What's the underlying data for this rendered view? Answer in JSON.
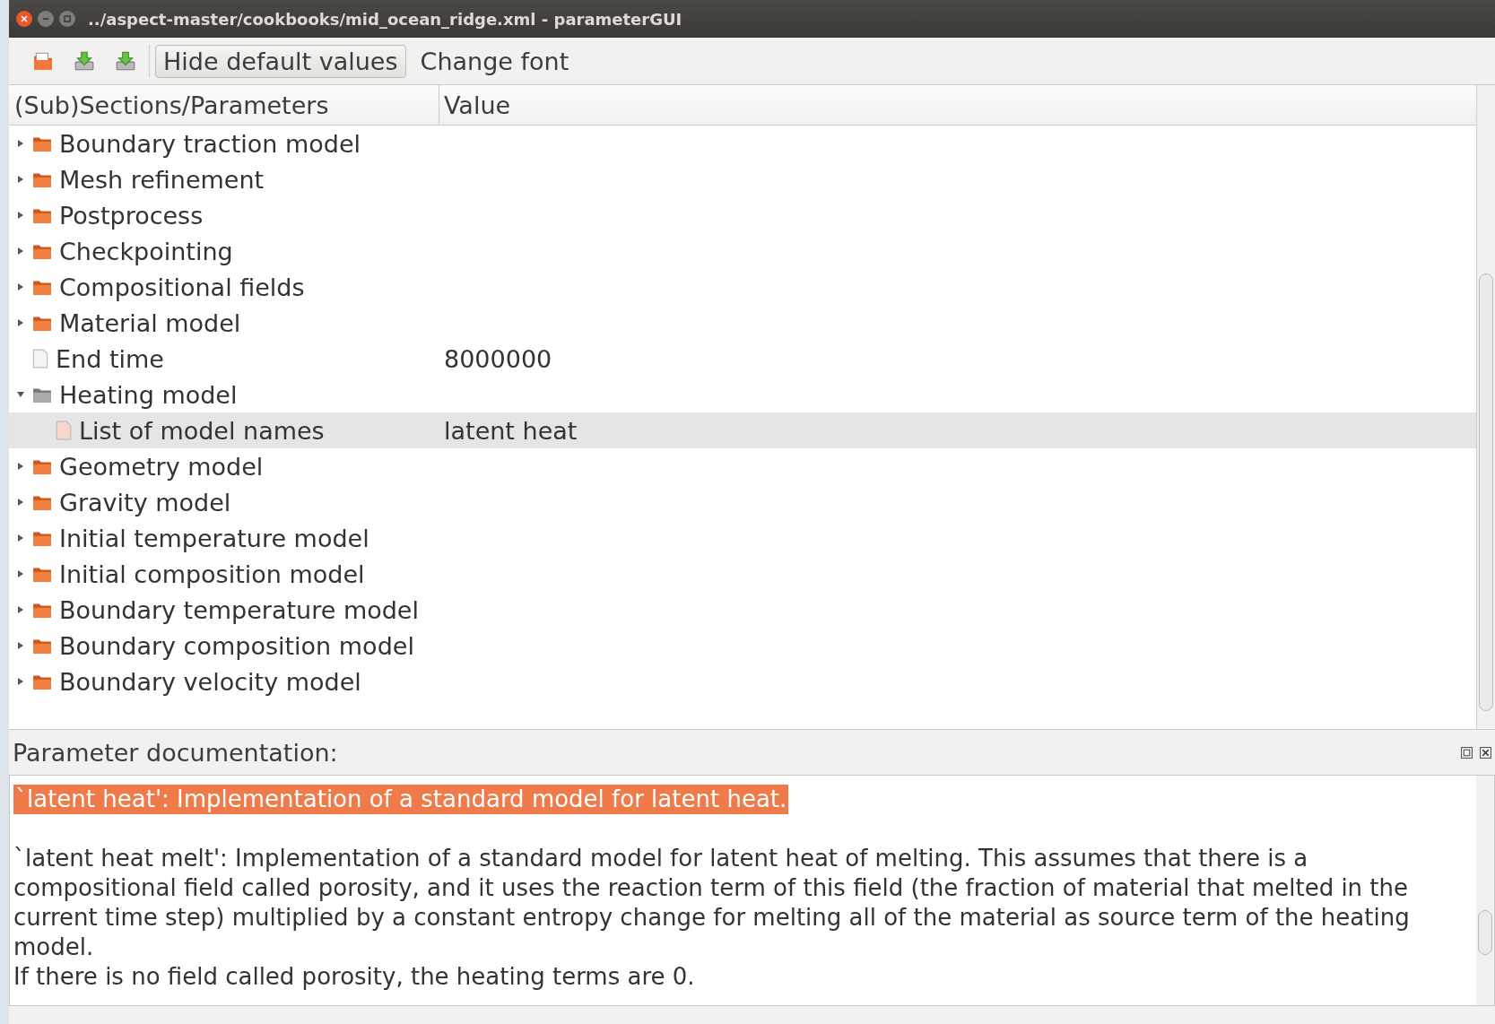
{
  "window": {
    "title": "../aspect-master/cookbooks/mid_ocean_ridge.xml - parameterGUI"
  },
  "toolbar": {
    "buttons": [
      {
        "label": "Hide default values",
        "kind": "button"
      },
      {
        "label": "Change font",
        "kind": "flat"
      }
    ]
  },
  "tree": {
    "columns": [
      "(Sub)Sections/Parameters",
      "Value"
    ],
    "items": [
      {
        "label": "Boundary traction model",
        "kind": "folder",
        "expanded": false,
        "selected": false
      },
      {
        "label": "Mesh refinement",
        "kind": "folder",
        "expanded": false,
        "selected": false
      },
      {
        "label": "Postprocess",
        "kind": "folder",
        "expanded": false,
        "selected": false
      },
      {
        "label": "Checkpointing",
        "kind": "folder",
        "expanded": false,
        "selected": false
      },
      {
        "label": "Compositional fields",
        "kind": "folder",
        "expanded": false,
        "selected": false
      },
      {
        "label": "Material model",
        "kind": "folder",
        "expanded": false,
        "selected": false
      },
      {
        "label": "End time",
        "kind": "file",
        "value": "8000000",
        "selected": false
      },
      {
        "label": "Heating model",
        "kind": "folder",
        "expanded": true,
        "selected": false,
        "children": [
          {
            "label": "List of model names",
            "kind": "file",
            "value": "latent heat",
            "selected": true
          }
        ]
      },
      {
        "label": "Geometry model",
        "kind": "folder",
        "expanded": false,
        "selected": false
      },
      {
        "label": "Gravity model",
        "kind": "folder",
        "expanded": false,
        "selected": false
      },
      {
        "label": "Initial temperature model",
        "kind": "folder",
        "expanded": false,
        "selected": false
      },
      {
        "label": "Initial composition model",
        "kind": "folder",
        "expanded": false,
        "selected": false
      },
      {
        "label": "Boundary temperature model",
        "kind": "folder",
        "expanded": false,
        "selected": false
      },
      {
        "label": "Boundary composition model",
        "kind": "folder",
        "expanded": false,
        "selected": false
      },
      {
        "label": "Boundary velocity model",
        "kind": "folder",
        "expanded": false,
        "selected": false
      }
    ]
  },
  "documentation": {
    "title": "Parameter documentation:",
    "paragraphs": [
      {
        "text": "`latent heat': Implementation of a standard model for latent heat.",
        "highlighted": true
      },
      {
        "text": "`latent heat melt': Implementation of a standard model for latent heat of melting. This assumes that there is a compositional field called porosity, and it uses the reaction term of this field (the fraction of material that melted in the current time step) multiplied by a constant entropy change for melting all of the material as source term of the heating model.",
        "highlighted": false
      },
      {
        "text": "If there is no field called porosity, the heating terms are 0.",
        "highlighted": false
      }
    ]
  }
}
